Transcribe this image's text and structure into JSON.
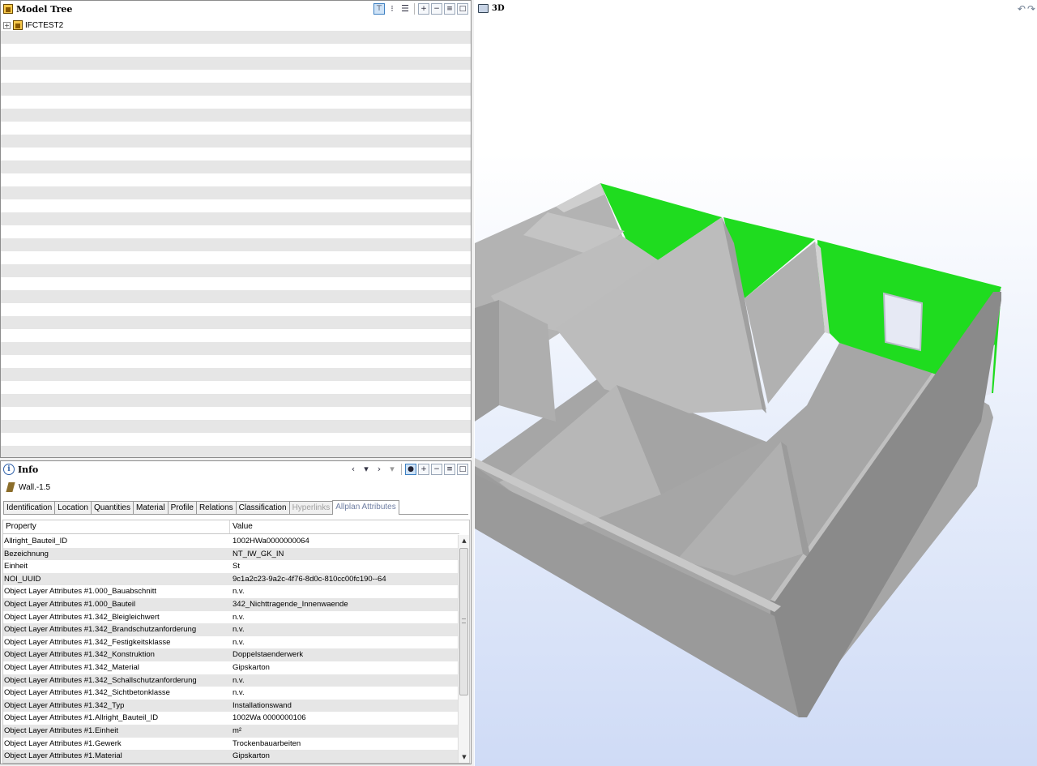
{
  "model_tree": {
    "title": "Model Tree",
    "root_item": "IFCTEST2",
    "expand_glyph": "+",
    "toolbar_icons": [
      "tree-view-icon",
      "flat-list-icon",
      "type-list-icon",
      "expand-all-icon",
      "collapse-all-icon",
      "list-icon",
      "maximize-icon"
    ]
  },
  "info": {
    "title": "Info",
    "selected_object": "Wall.-1.5",
    "nav": {
      "back": "‹",
      "forward": "›"
    },
    "tabs": [
      {
        "label": "Identification",
        "state": "normal"
      },
      {
        "label": "Location",
        "state": "normal"
      },
      {
        "label": "Quantities",
        "state": "normal"
      },
      {
        "label": "Material",
        "state": "normal"
      },
      {
        "label": "Profile",
        "state": "normal"
      },
      {
        "label": "Relations",
        "state": "normal"
      },
      {
        "label": "Classification",
        "state": "normal"
      },
      {
        "label": "Hyperlinks",
        "state": "disabled"
      },
      {
        "label": "Allplan Attributes",
        "state": "active"
      }
    ],
    "table": {
      "headers": [
        "Property",
        "Value"
      ],
      "rows": [
        [
          "Allright_Bauteil_ID",
          "1002HWa0000000064"
        ],
        [
          "Bezeichnung",
          "NT_IW_GK_IN"
        ],
        [
          "Einheit",
          "St"
        ],
        [
          "NOI_UUID",
          "9c1a2c23-9a2c-4f76-8d0c-810cc00fc190--64"
        ],
        [
          "Object Layer Attributes #1.000_Bauabschnitt",
          "n.v."
        ],
        [
          "Object Layer Attributes #1.000_Bauteil",
          "342_Nichttragende_Innenwaende"
        ],
        [
          "Object Layer Attributes #1.342_Bleigleichwert",
          "n.v."
        ],
        [
          "Object Layer Attributes #1.342_Brandschutzanforderung",
          "n.v."
        ],
        [
          "Object Layer Attributes #1.342_Festigkeitsklasse",
          "n.v."
        ],
        [
          "Object Layer Attributes #1.342_Konstruktion",
          "Doppelstaenderwerk"
        ],
        [
          "Object Layer Attributes #1.342_Material",
          "Gipskarton"
        ],
        [
          "Object Layer Attributes #1.342_Schallschutzanforderung",
          "n.v."
        ],
        [
          "Object Layer Attributes #1.342_Sichtbetonklasse",
          "n.v."
        ],
        [
          "Object Layer Attributes #1.342_Typ",
          "Installationswand"
        ],
        [
          "Object Layer Attributes #1.Allright_Bauteil_ID",
          "1002Wa 0000000106"
        ],
        [
          "Object Layer Attributes #1.Einheit",
          "m²"
        ],
        [
          "Object Layer Attributes #1.Gewerk",
          "Trockenbauarbeiten"
        ],
        [
          "Object Layer Attributes #1.Material",
          "Gipskarton"
        ]
      ]
    }
  },
  "view3d": {
    "title": "3D",
    "colors": {
      "highlight": "#1fdc1f",
      "wall": "#a9a9a9",
      "background": "#cfdbf6"
    }
  }
}
